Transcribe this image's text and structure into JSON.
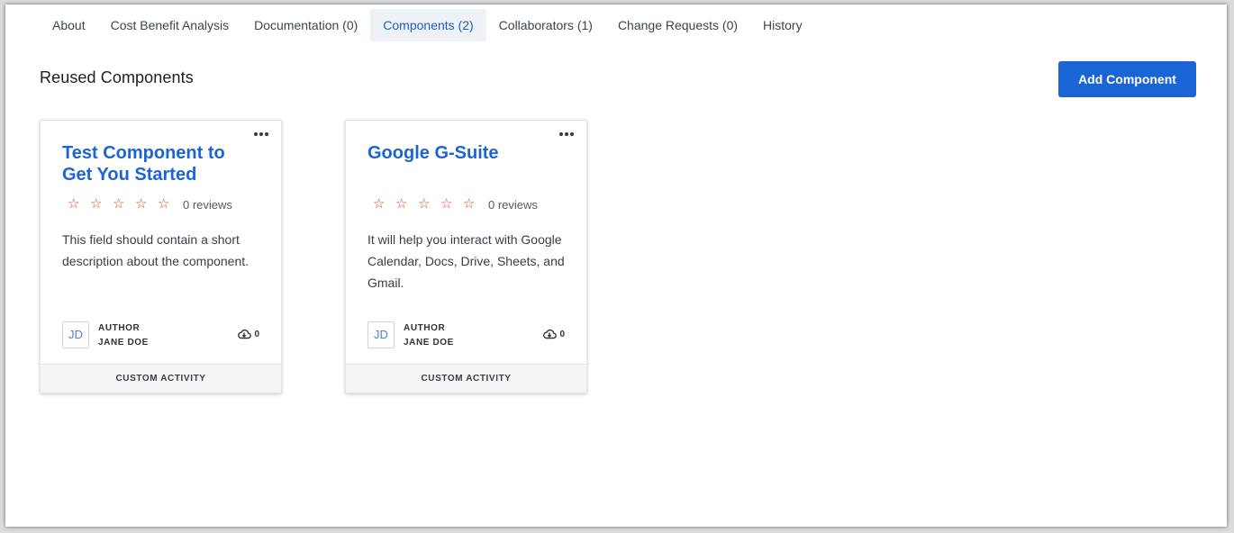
{
  "tabs": [
    {
      "label": "About"
    },
    {
      "label": "Cost Benefit Analysis"
    },
    {
      "label": "Documentation (0)"
    },
    {
      "label": "Components (2)"
    },
    {
      "label": "Collaborators (1)"
    },
    {
      "label": "Change Requests (0)"
    },
    {
      "label": "History"
    }
  ],
  "active_tab": "Components (2)",
  "section": {
    "title": "Reused Components",
    "add_button_label": "Add Component"
  },
  "cards": [
    {
      "title": "Test Component to Get You Started",
      "rating": 0,
      "reviews_text": "0 reviews",
      "description": "This field should contain a short description about the component.",
      "author_initials": "JD",
      "author_label": "AUTHOR",
      "author_name": "JANE DOE",
      "downloads": "0",
      "footer": "CUSTOM ACTIVITY"
    },
    {
      "title": "Google G-Suite",
      "rating": 0,
      "reviews_text": "0 reviews",
      "description": "It will help you interact with Google Calendar, Docs, Drive, Sheets, and Gmail.",
      "author_initials": "JD",
      "author_label": "AUTHOR",
      "author_name": "JANE DOE",
      "downloads": "0",
      "footer": "CUSTOM ACTIVITY"
    }
  ],
  "colors": {
    "accent": "#1b64d6",
    "star": "#dc4a18",
    "active_tab_bg": "#eef1f6"
  },
  "icons": {
    "card_menu": "more-horizontal-icon",
    "star": "star-outline-icon",
    "downloads": "cloud-download-icon"
  }
}
